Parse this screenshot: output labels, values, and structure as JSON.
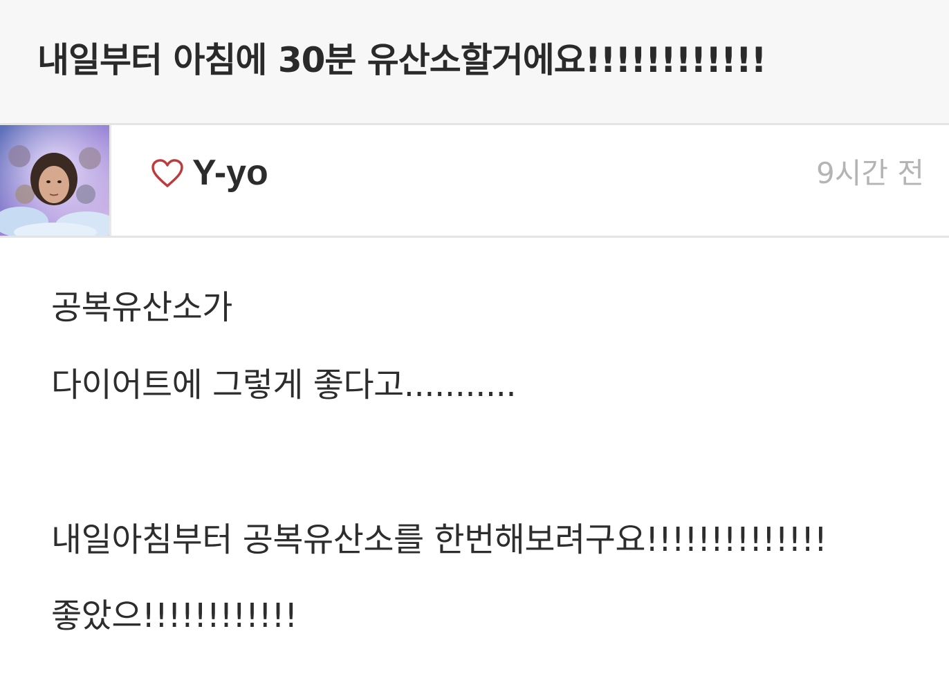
{
  "post": {
    "title": "내일부터 아침에 30분 유산소할거에요!!!!!!!!!!!!",
    "author": "Y-yo",
    "time_ago": "9시간 전",
    "avatar_icon": "profile-photo",
    "like_icon": "heart-outline-icon",
    "like_color": "#c0393b",
    "body_lines": [
      " 공복유산소가",
      "다이어트에 그렇게 좋다고...........",
      "내일아침부터 공복유산소를 한번해보려구요!!!!!!!!!!!!!!",
      "좋았으!!!!!!!!!!!!"
    ]
  }
}
